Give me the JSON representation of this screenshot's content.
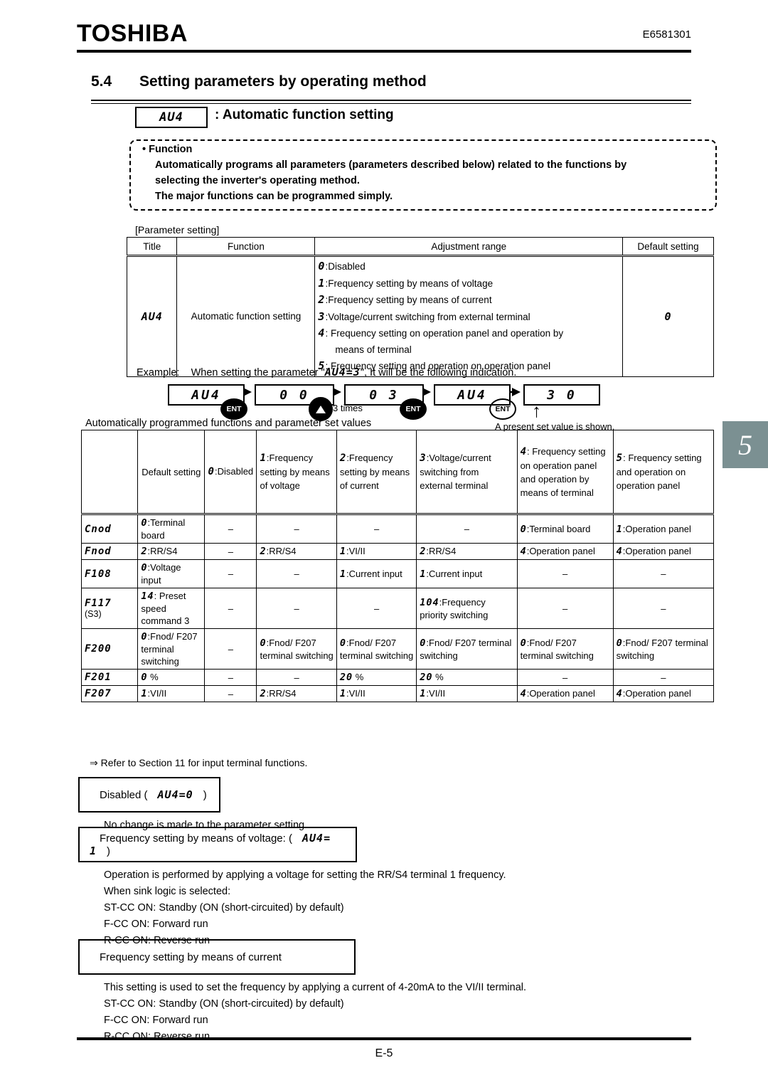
{
  "header": {
    "logo": "TOSHIBA",
    "doc_id": "E6581301"
  },
  "section": {
    "number": "5.4",
    "title": "Setting parameters by operating method",
    "param_code": "AU4",
    "param_title": ": Automatic function setting"
  },
  "function_box": {
    "bullet": "• Function",
    "line1": "Automatically programs all parameters (parameters described below) related to the functions by",
    "line2": "selecting the inverter's operating method.",
    "line3": "The major functions can be programmed simply."
  },
  "parameter_setting": {
    "label": "[Parameter setting]",
    "columns": [
      "Title",
      "Function",
      "Adjustment range",
      "Default setting"
    ],
    "row": {
      "title": "AU4",
      "function": "Automatic function setting",
      "adjustment_range": [
        {
          "code": "0",
          "text": ":Disabled",
          "indent": false
        },
        {
          "code": "1",
          "text": ":Frequency setting by means of voltage",
          "indent": false
        },
        {
          "code": "2",
          "text": ":Frequency setting by means of current",
          "indent": false
        },
        {
          "code": "3",
          "text": ":Voltage/current switching from external terminal",
          "indent": false
        },
        {
          "code": "4",
          "text": ": Frequency setting on operation panel and operation by",
          "indent": false
        },
        {
          "code": "",
          "text": "means of terminal",
          "indent": true
        },
        {
          "code": "5",
          "text": ": Frequency setting and operation on operation panel",
          "indent": false
        }
      ],
      "default_setting": "0"
    }
  },
  "example": {
    "prefix": "Example:",
    "text_before": "When setting the parameter \"",
    "param_expr": "AU4=3",
    "text_after": "\", It will be the following indication.",
    "steps": [
      {
        "display": "AU4",
        "key": "ENT",
        "key_style": "filled"
      },
      {
        "display": "0  0",
        "key": "UP",
        "key_label": "3 times"
      },
      {
        "display": "0  3",
        "key": "ENT",
        "key_style": "filled"
      },
      {
        "display": "AU4",
        "key": "ENT",
        "key_style": "filled"
      },
      {
        "display": "3  0",
        "key": "",
        "key_style": ""
      }
    ],
    "present_note": "A present set value is shown."
  },
  "auto_table": {
    "caption": "Automatically programmed functions and parameter set values",
    "page_tab": "5",
    "page_tab_color": "#7b9092",
    "headers": [
      {
        "code": "",
        "text": ""
      },
      {
        "code": "",
        "text": "Default setting"
      },
      {
        "code": "0",
        "text": ":Disabled"
      },
      {
        "code": "1",
        "text": ":Frequency setting by means of voltage"
      },
      {
        "code": "2",
        "text": ":Frequency setting by means of current"
      },
      {
        "code": "3",
        "text": ":Voltage/current switching from external terminal"
      },
      {
        "code": "4",
        "text": ": Frequency setting on operation panel and operation by means of terminal"
      },
      {
        "code": "5",
        "text": ": Frequency setting and operation on operation panel"
      }
    ],
    "rows": [
      {
        "param": "Cnod",
        "sub": "",
        "cells": [
          {
            "code": "0",
            "text": ":Terminal board"
          },
          {
            "code": "",
            "text": "–"
          },
          {
            "code": "",
            "text": "–"
          },
          {
            "code": "",
            "text": "–"
          },
          {
            "code": "",
            "text": "–"
          },
          {
            "code": "0",
            "text": ":Terminal board"
          },
          {
            "code": "1",
            "text": ":Operation panel"
          }
        ]
      },
      {
        "param": "Fnod",
        "sub": "",
        "cells": [
          {
            "code": "2",
            "text": ":RR/S4"
          },
          {
            "code": "",
            "text": "–"
          },
          {
            "code": "2",
            "text": ":RR/S4"
          },
          {
            "code": "1",
            "text": ":VI/II"
          },
          {
            "code": "2",
            "text": ":RR/S4"
          },
          {
            "code": "4",
            "text": ":Operation panel"
          },
          {
            "code": "4",
            "text": ":Operation panel"
          }
        ]
      },
      {
        "param": "F108",
        "sub": "",
        "cells": [
          {
            "code": "0",
            "text": ":Voltage input"
          },
          {
            "code": "",
            "text": "–"
          },
          {
            "code": "",
            "text": "–"
          },
          {
            "code": "1",
            "text": ":Current input"
          },
          {
            "code": "1",
            "text": ":Current input"
          },
          {
            "code": "",
            "text": "–"
          },
          {
            "code": "",
            "text": "–"
          }
        ]
      },
      {
        "param": "F117",
        "sub": "(S3)",
        "cells": [
          {
            "code": "14",
            "text": ": Preset speed command 3"
          },
          {
            "code": "",
            "text": "–"
          },
          {
            "code": "",
            "text": "–"
          },
          {
            "code": "",
            "text": "–"
          },
          {
            "code": "104",
            "text": ":Frequency priority switching"
          },
          {
            "code": "",
            "text": "–"
          },
          {
            "code": "",
            "text": "–"
          }
        ]
      },
      {
        "param": "F200",
        "sub": "",
        "cells": [
          {
            "code": "0",
            "text": ":Fnod/ F207 terminal switching"
          },
          {
            "code": "",
            "text": "–"
          },
          {
            "code": "0",
            "text": ":Fnod/ F207 terminal switching"
          },
          {
            "code": "0",
            "text": ":Fnod/ F207 terminal switching"
          },
          {
            "code": "0",
            "text": ":Fnod/ F207 terminal switching"
          },
          {
            "code": "0",
            "text": ":Fnod/ F207 terminal switching"
          },
          {
            "code": "0",
            "text": ":Fnod/ F207 terminal switching"
          }
        ]
      },
      {
        "param": "F201",
        "sub": "",
        "cells": [
          {
            "code": "0",
            "text": " %"
          },
          {
            "code": "",
            "text": "–"
          },
          {
            "code": "",
            "text": "–"
          },
          {
            "code": "20",
            "text": " %"
          },
          {
            "code": "20",
            "text": " %"
          },
          {
            "code": "",
            "text": "–"
          },
          {
            "code": "",
            "text": "–"
          }
        ]
      },
      {
        "param": "F207",
        "sub": "",
        "cells": [
          {
            "code": "1",
            "text": ":VI/II"
          },
          {
            "code": "",
            "text": "–"
          },
          {
            "code": "2",
            "text": ":RR/S4"
          },
          {
            "code": "1",
            "text": ":VI/II"
          },
          {
            "code": "1",
            "text": ":VI/II"
          },
          {
            "code": "4",
            "text": ":Operation panel"
          },
          {
            "code": "4",
            "text": ":Operation panel"
          }
        ]
      }
    ]
  },
  "notes": {
    "ref_note": "⇒ Refer to Section 11 for input terminal functions.",
    "block1": {
      "box_prefix": "Disabled (",
      "box_code": "AU4=0",
      "box_suffix": ")",
      "lines": [
        "No change is made to the parameter setting."
      ]
    },
    "block2": {
      "box_prefix": "Frequency setting by means of voltage: (",
      "box_code": "AU4= 1",
      "box_suffix": ")",
      "lines": [
        "Operation is performed by applying a voltage for setting the RR/S4 terminal 1 frequency.",
        "When sink logic is selected:",
        "ST-CC ON:  Standby (ON (short-circuited) by default)",
        "F-CC ON:    Forward run",
        "R-CC ON:    Reverse run"
      ]
    },
    "block3": {
      "box_prefix": "Frequency setting by means of current",
      "box_code": "",
      "box_suffix": "",
      "lines": [
        "This setting is used to set the frequency by applying a current of 4-20mA to the VI/II terminal.",
        "ST-CC ON:  Standby (ON (short-circuited) by default)",
        "F-CC ON:    Forward run",
        "R-CC ON:    Reverse run"
      ]
    }
  },
  "footer": {
    "page": "E-5"
  }
}
